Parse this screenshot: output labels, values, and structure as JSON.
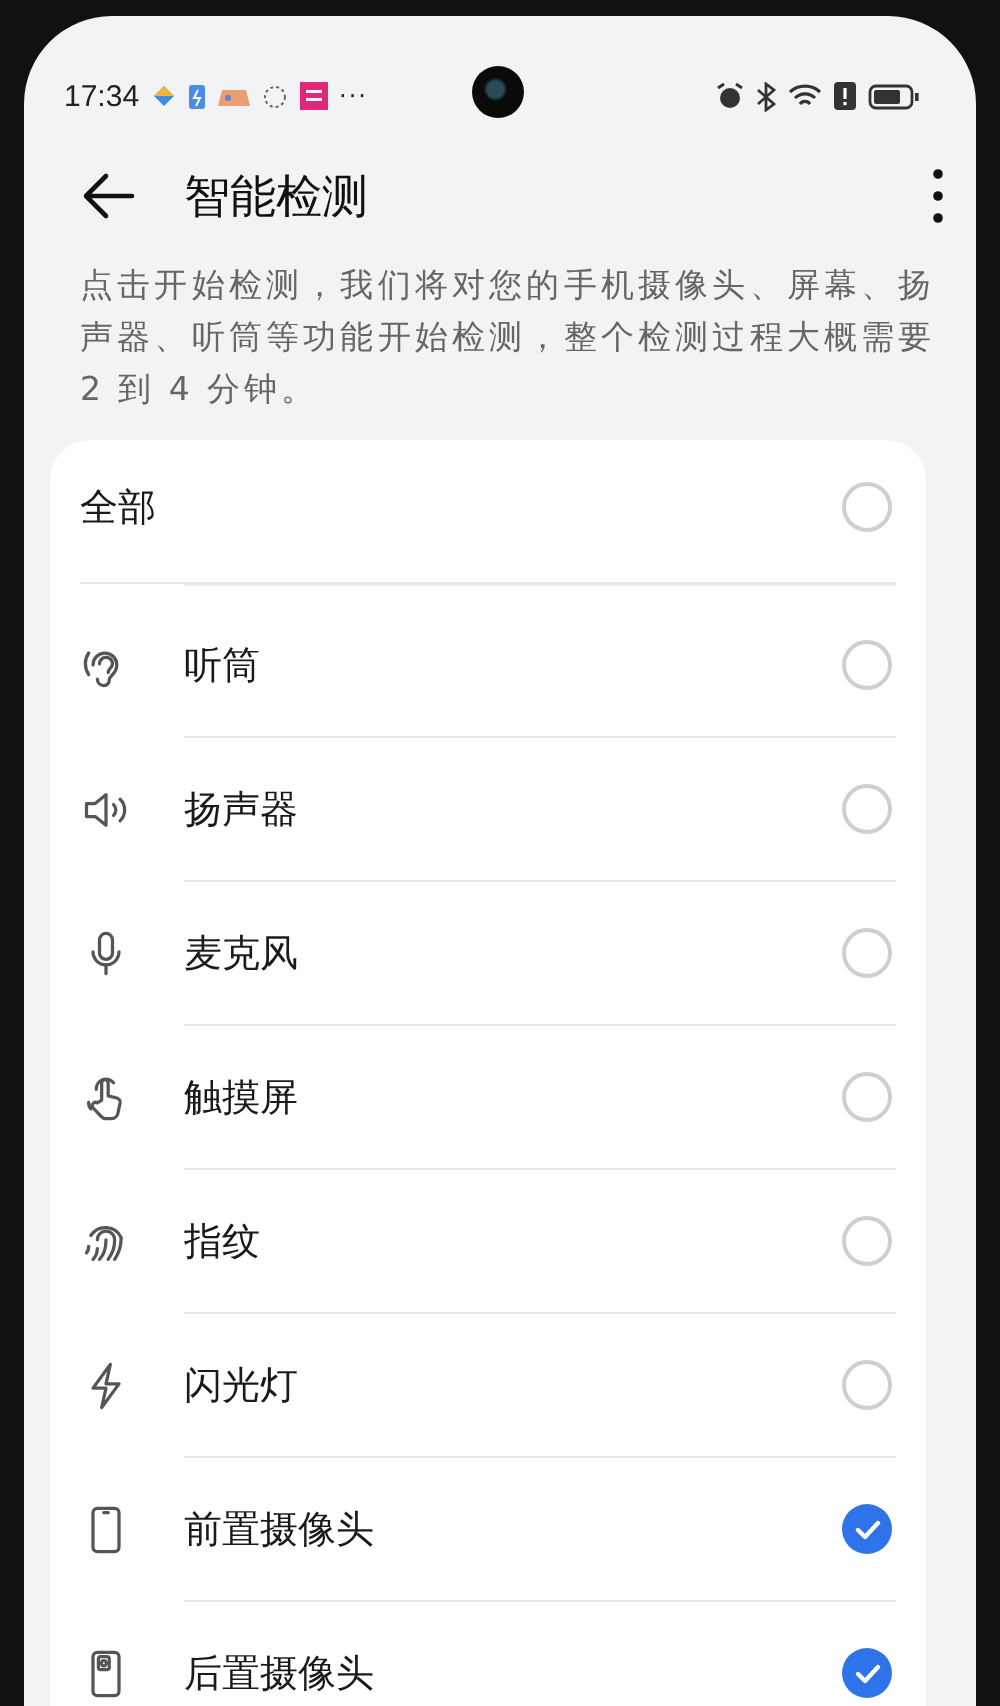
{
  "status_bar": {
    "time": "17:34",
    "more": "···"
  },
  "header": {
    "title": "智能检测"
  },
  "description": "点击开始检测，我们将对您的手机摄像头、屏幕、扬声器、听筒等功能开始检测，整个检测过程大概需要 2 到 4 分钟。",
  "select_all": {
    "label": "全部",
    "selected": false
  },
  "items": [
    {
      "kind": "earpiece",
      "label": "听筒",
      "selected": false
    },
    {
      "kind": "speaker",
      "label": "扬声器",
      "selected": false
    },
    {
      "kind": "microphone",
      "label": "麦克风",
      "selected": false
    },
    {
      "kind": "touch",
      "label": "触摸屏",
      "selected": false
    },
    {
      "kind": "fingerprint",
      "label": "指纹",
      "selected": false
    },
    {
      "kind": "flash",
      "label": "闪光灯",
      "selected": false
    },
    {
      "kind": "front_camera",
      "label": "前置摄像头",
      "selected": true
    },
    {
      "kind": "rear_camera",
      "label": "后置摄像头",
      "selected": true
    }
  ]
}
